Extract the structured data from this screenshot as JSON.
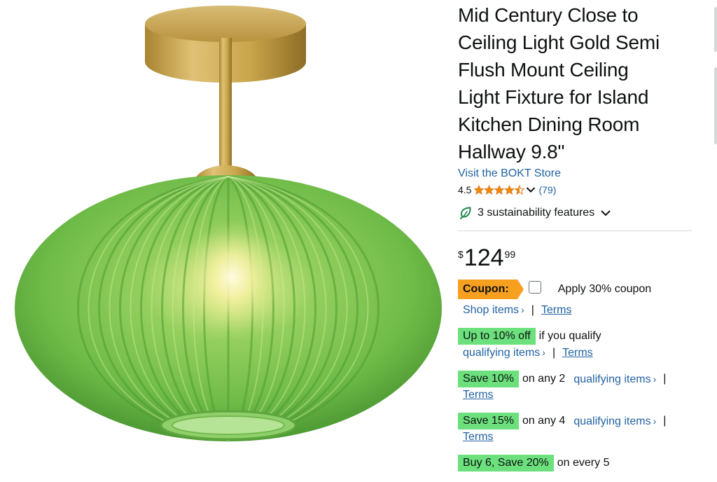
{
  "product": {
    "title": "Mid Century Close to Ceiling Light Gold Semi Flush Mount Ceiling Light Fixture for Island Kitchen Dining Room Hallway 9.8\"",
    "title_lines": [
      "Mid Century Close to",
      "Ceiling Light Gold Semi",
      "Flush Mount Ceiling",
      "Light Fixture for Island",
      "Kitchen Dining Room",
      "Hallway 9.8\""
    ],
    "store_link": "Visit the BOKT Store",
    "rating": "4.5",
    "rating_value": 4.5,
    "review_count": "(79)",
    "sustainability": "3 sustainability features",
    "price": {
      "symbol": "$",
      "whole": "124",
      "fraction": "99"
    }
  },
  "coupon": {
    "badge": "Coupon:",
    "text": "Apply 30% coupon",
    "shop_link": "Shop items",
    "terms": "Terms"
  },
  "deals": [
    {
      "badge": "Up to 10% off",
      "text": "if you qualify",
      "link": "qualifying items",
      "terms": "Terms"
    },
    {
      "badge": "Save 10%",
      "text": "on any 2",
      "link": "qualifying items",
      "terms": "Terms"
    },
    {
      "badge": "Save 15%",
      "text": "on any 4",
      "link": "qualifying items",
      "terms": "Terms"
    },
    {
      "badge": "Buy 6, Save 20%",
      "text": "on every 5"
    }
  ],
  "icons": {
    "chevron": "chevron-down-icon",
    "leaf": "leaf-icon",
    "star": "star-icon"
  },
  "colors": {
    "link": "#2162a1",
    "coupon_badge": "#f7a01f",
    "deal_badge": "#6be07c",
    "star": "#f08804",
    "lamp_glass": "#7fc651",
    "lamp_metal": "#c9a64b"
  }
}
